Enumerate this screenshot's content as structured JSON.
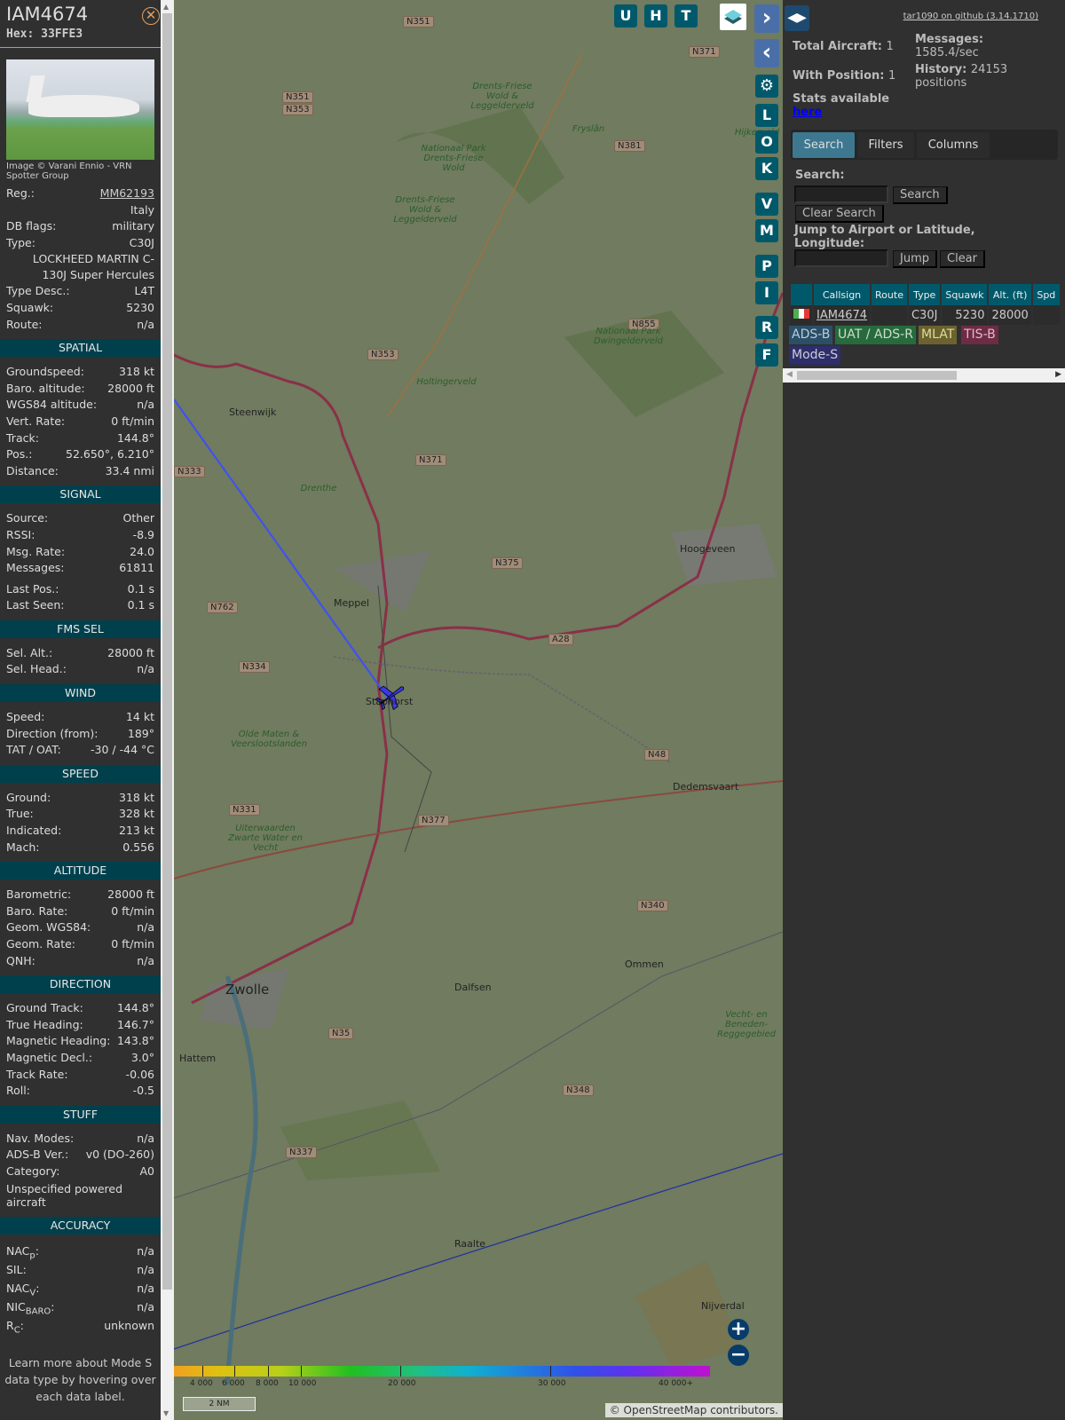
{
  "aircraft": {
    "callsign": "IAM4674",
    "hex_label": "Hex:",
    "hex": "33FFE3",
    "photo_credit": "Image © Varani Ennio - VRN Spotter Group"
  },
  "details": [
    {
      "label": "Reg.:",
      "value": "MM62193",
      "link": true
    },
    {
      "label": "",
      "value": "Italy"
    },
    {
      "label": "DB flags:",
      "value": "military"
    },
    {
      "label": "Type:",
      "value": "C30J"
    },
    {
      "label": "",
      "value": "LOCKHEED MARTIN C-130J Super Hercules",
      "wrap": true
    },
    {
      "label": "Type Desc.:",
      "value": "L4T"
    },
    {
      "label": "Squawk:",
      "value": "5230"
    },
    {
      "label": "Route:",
      "value": "n/a"
    }
  ],
  "sections": [
    {
      "title": "SPATIAL",
      "rows": [
        [
          "Groundspeed:",
          "318 kt"
        ],
        [
          "Baro. altitude:",
          "28000 ft"
        ],
        [
          "WGS84 altitude:",
          "n/a"
        ],
        [
          "Vert. Rate:",
          "0 ft/min"
        ],
        [
          "Track:",
          "144.8°"
        ],
        [
          "Pos.:",
          "52.650°, 6.210°"
        ],
        [
          "Distance:",
          "33.4 nmi"
        ]
      ]
    },
    {
      "title": "SIGNAL",
      "rows": [
        [
          "Source:",
          "Other"
        ],
        [
          "RSSI:",
          "-8.9"
        ],
        [
          "Msg. Rate:",
          "24.0"
        ],
        [
          "Messages:",
          "61811"
        ],
        [
          "",
          ""
        ],
        [
          "Last Pos.:",
          "0.1 s"
        ],
        [
          "Last Seen:",
          "0.1 s"
        ]
      ]
    },
    {
      "title": "FMS SEL",
      "rows": [
        [
          "Sel. Alt.:",
          "28000 ft"
        ],
        [
          "Sel. Head.:",
          "n/a"
        ]
      ]
    },
    {
      "title": "WIND",
      "rows": [
        [
          "Speed:",
          "14 kt"
        ],
        [
          "Direction (from):",
          "189°"
        ],
        [
          "TAT / OAT:",
          "-30 / -44 °C"
        ]
      ]
    },
    {
      "title": "SPEED",
      "rows": [
        [
          "Ground:",
          "318 kt"
        ],
        [
          "True:",
          "328 kt"
        ],
        [
          "Indicated:",
          "213 kt"
        ],
        [
          "Mach:",
          "0.556"
        ]
      ]
    },
    {
      "title": "ALTITUDE",
      "rows": [
        [
          "Barometric:",
          "28000 ft"
        ],
        [
          "Baro. Rate:",
          "0 ft/min"
        ],
        [
          "Geom. WGS84:",
          "n/a"
        ],
        [
          "Geom. Rate:",
          "0 ft/min"
        ],
        [
          "QNH:",
          "n/a"
        ]
      ]
    },
    {
      "title": "DIRECTION",
      "rows": [
        [
          "Ground Track:",
          "144.8°"
        ],
        [
          "True Heading:",
          "146.7°"
        ],
        [
          "Magnetic Heading:",
          "143.8°"
        ],
        [
          "Magnetic Decl.:",
          "3.0°"
        ],
        [
          "Track Rate:",
          "-0.06"
        ],
        [
          "Roll:",
          "-0.5"
        ]
      ]
    },
    {
      "title": "STUFF",
      "rows": [
        [
          "Nav. Modes:",
          "n/a"
        ],
        [
          "ADS-B Ver.:",
          "v0 (DO-260)"
        ],
        [
          "Category:",
          "A0"
        ],
        [
          "Unspecified powered aircraft",
          ""
        ]
      ]
    },
    {
      "title": "ACCURACY",
      "rows": [
        [
          "NAC",
          "p",
          ":",
          "n/a"
        ],
        [
          "SIL:",
          "",
          "",
          "n/a"
        ],
        [
          "NAC",
          "V",
          ":",
          "n/a"
        ],
        [
          "NIC",
          "BARO",
          ":",
          "n/a"
        ],
        [
          "R",
          "C",
          ":",
          "unknown"
        ]
      ]
    }
  ],
  "footer_note": "Learn more about Mode S data type by hovering over each data label.",
  "map": {
    "top_buttons": [
      "U",
      "H",
      "T"
    ],
    "side_buttons": [
      "L",
      "O",
      "K",
      "V",
      "M",
      "P",
      "I",
      "R",
      "F"
    ],
    "labels": [
      "N351",
      "N351",
      "N353",
      "N371",
      "N381",
      "Drents-Friese Wold & Leggelderveld",
      "Nationaal Park Drents-Friese Wold",
      "Drents-Friese Wold & Leggelderveld",
      "Hijkerveld",
      "N855",
      "Nationaal Park Dwingelderveld",
      "N353",
      "Holtingerveld",
      "Steenwijk",
      "N371",
      "N375",
      "Meppel",
      "A28",
      "Hoogeveen",
      "N762",
      "N334",
      "Staphorst",
      "Olde Maten & Veerslootslanden",
      "N48",
      "N377",
      "Dedemsvaart",
      "N331",
      "Uiterwaarden Zwarte Water en Vecht",
      "N340",
      "Ommen",
      "Zwolle",
      "Dalfsen",
      "N35",
      "Vecht- en Beneden-Reggegebied",
      "Hattem",
      "N348",
      "N337",
      "Raalte",
      "Nijverdal",
      "N333",
      "Fryslân",
      "Drenthe",
      "Drenthe"
    ],
    "legend_ticks": [
      "4 000",
      "6 000",
      "8 000",
      "10 000",
      "20 000",
      "30 000",
      "40 000+"
    ],
    "scale": "2 NM",
    "attribution_prefix": "© ",
    "attribution_link": "OpenStreetMap",
    "attribution_suffix": " contributors."
  },
  "right": {
    "github": "tar1090 on github (3.14.1710)",
    "total_aircraft_label": "Total Aircraft:",
    "total_aircraft": "1",
    "with_position_label": "With Position:",
    "with_position": "1",
    "stats_label": "Stats available",
    "stats_link": "here",
    "messages_label": "Messages:",
    "messages": "1585.4/sec",
    "history_label": "History:",
    "history": "24153 positions",
    "tabs": [
      "Search",
      "Filters",
      "Columns"
    ],
    "search_label": "Search:",
    "search_value": "",
    "search_btn": "Search",
    "clear_search_btn": "Clear Search",
    "jump_label": "Jump to Airport or Latitude, Longitude:",
    "jump_value": "",
    "jump_btn": "Jump",
    "clear_btn": "Clear",
    "columns": [
      "",
      "Callsign",
      "Route",
      "Type",
      "Squawk",
      "Alt. (ft)",
      "Spd"
    ],
    "row": {
      "flag": "Italy",
      "callsign": "IAM4674",
      "route": "",
      "type": "C30J",
      "squawk": "5230",
      "alt": "28000",
      "spd": ""
    },
    "badges": [
      {
        "text": "ADS-B",
        "bg": "#2a4f66",
        "fg": "#bcd"
      },
      {
        "text": "UAT / ADS-R",
        "bg": "#276b3c",
        "fg": "#cdc"
      },
      {
        "text": "MLAT",
        "bg": "#6b6230",
        "fg": "#dd9"
      },
      {
        "text": "TIS-B",
        "bg": "#6e2b44",
        "fg": "#dbc"
      },
      {
        "text": "Mode-S",
        "bg": "#2e2e6a",
        "fg": "#ccd"
      }
    ]
  }
}
